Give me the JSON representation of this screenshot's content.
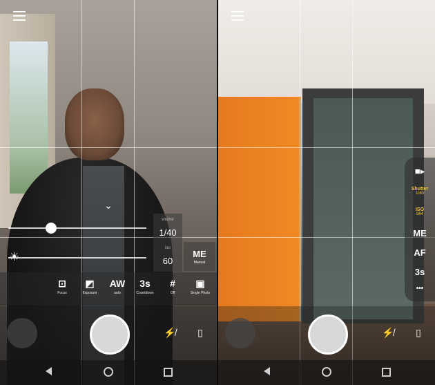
{
  "left": {
    "manual_panel": {
      "shutter_label": "shutter",
      "shutter_value": "1/40",
      "iso_label": "iso",
      "iso_value": "60",
      "me_label": "ME",
      "me_sub": "Manual"
    },
    "modes": [
      {
        "icon": "focus-icon",
        "glyph": "⊡",
        "label": "Focus"
      },
      {
        "icon": "exposure-icon",
        "glyph": "◩",
        "label": "Exposure"
      },
      {
        "icon": "awb-icon",
        "glyph": "AW",
        "label": "auto"
      },
      {
        "icon": "countdown-icon",
        "glyph": "3s",
        "label": "Countdown"
      },
      {
        "icon": "grid-icon",
        "glyph": "#",
        "label": "Off"
      },
      {
        "icon": "single-photo-icon",
        "glyph": "▣",
        "label": "Single Photo"
      }
    ]
  },
  "right": {
    "side_menu": {
      "shutter_label": "Shutter",
      "shutter_value": "1/40",
      "iso_label": "ISO",
      "iso_value": "964",
      "me": "ME",
      "af": "AF",
      "timer": "3s",
      "more": "•••"
    }
  },
  "colors": {
    "accent": "#f4c430"
  }
}
